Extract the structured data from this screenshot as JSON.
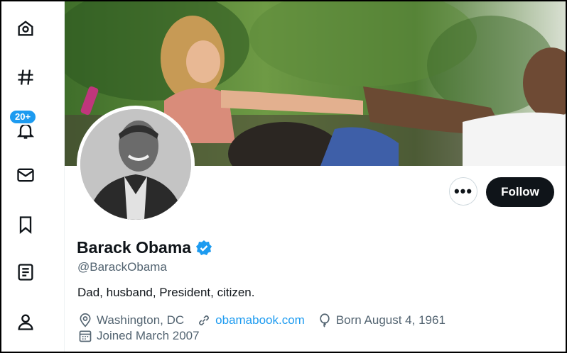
{
  "sidebar": {
    "items": [
      {
        "name": "home-icon"
      },
      {
        "name": "explore-icon"
      },
      {
        "name": "notifications-icon",
        "badge": "20+"
      },
      {
        "name": "messages-icon"
      },
      {
        "name": "bookmarks-icon"
      },
      {
        "name": "lists-icon"
      },
      {
        "name": "profile-icon"
      }
    ]
  },
  "profile": {
    "name": "Barack Obama",
    "handle": "@BarackObama",
    "bio": "Dad, husband, President, citizen.",
    "location": "Washington, DC",
    "website": "obamabook.com",
    "birthday": "Born August 4, 1961",
    "joined": "Joined March 2007",
    "verified": true
  },
  "actions": {
    "more_label": "•••",
    "follow_label": "Follow"
  },
  "colors": {
    "accent": "#1d9bf0",
    "text": "#0f1419",
    "secondary": "#536471",
    "follow_bg": "#0f1419"
  }
}
